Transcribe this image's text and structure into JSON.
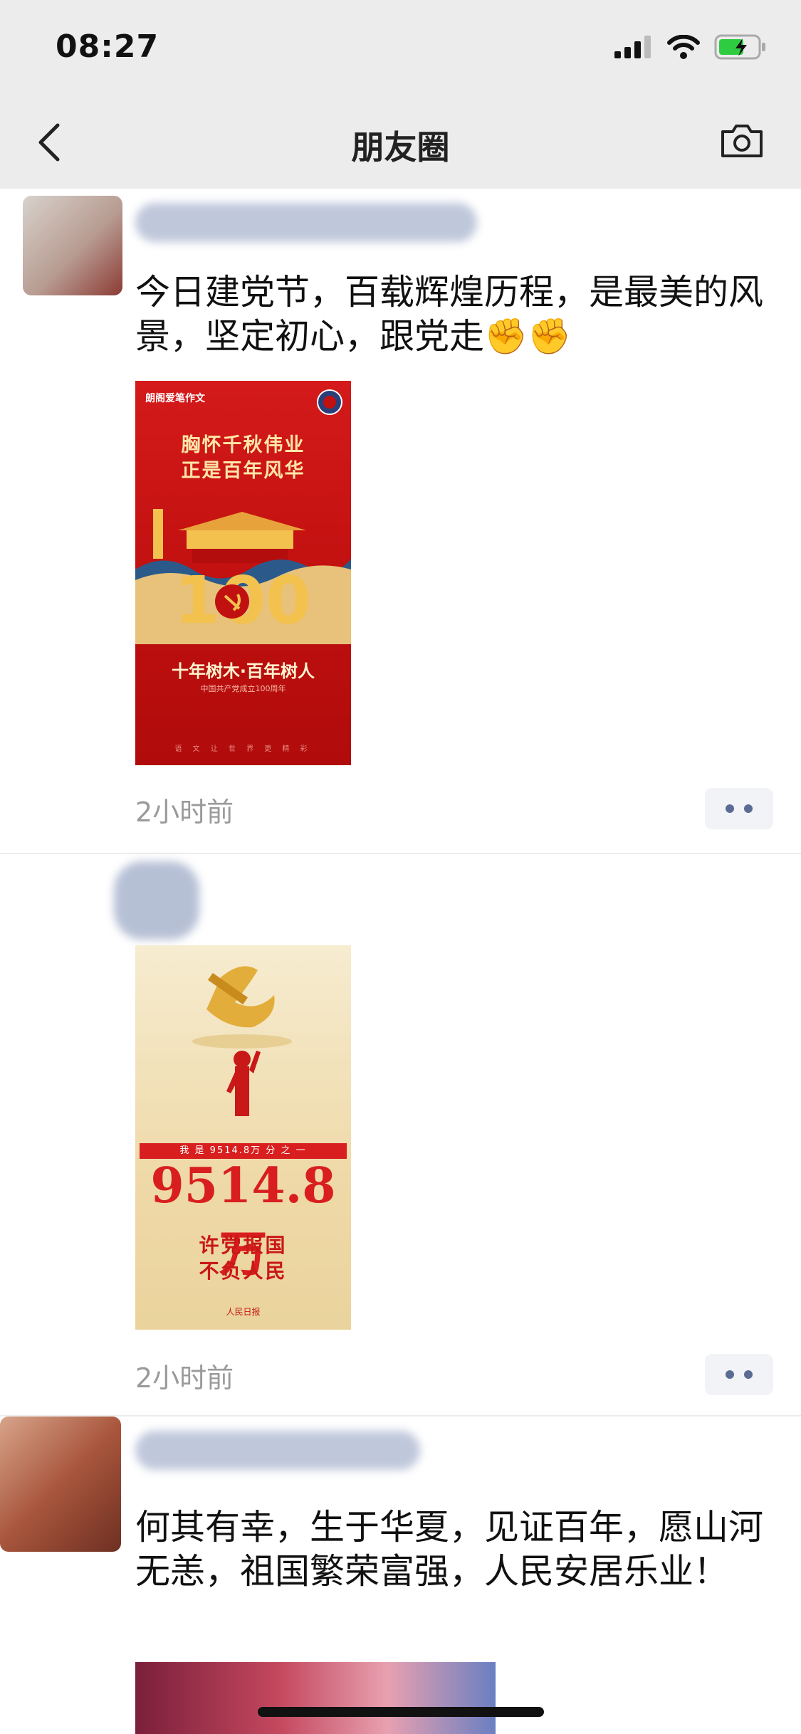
{
  "status_bar": {
    "time": "08:27"
  },
  "nav": {
    "title": "朋友圈"
  },
  "posts": [
    {
      "text": "今日建党节，百载辉煌历程，是最美的风景，坚定初心，跟党走✊✊",
      "time_ago": "2小时前",
      "image": {
        "brand": "朗阁爱笔作文",
        "line1": "胸怀千秋伟业",
        "line2": "正是百年风华",
        "slogan": "十年树木·百年树人",
        "small": "中国共产党成立100周年",
        "footer": "语 文 让 世 界 更 精 彩"
      }
    },
    {
      "text": "",
      "time_ago": "2小时前",
      "image": {
        "band": "我 是 9514.8万 分 之 一",
        "big": "9514.8万",
        "line1": "许党报国",
        "line2": "不负人民",
        "logo": "人民日报"
      }
    },
    {
      "text": "何其有幸，生于华夏，见证百年，愿山河无恙，祖国繁荣富强，人民安居乐业！"
    }
  ]
}
